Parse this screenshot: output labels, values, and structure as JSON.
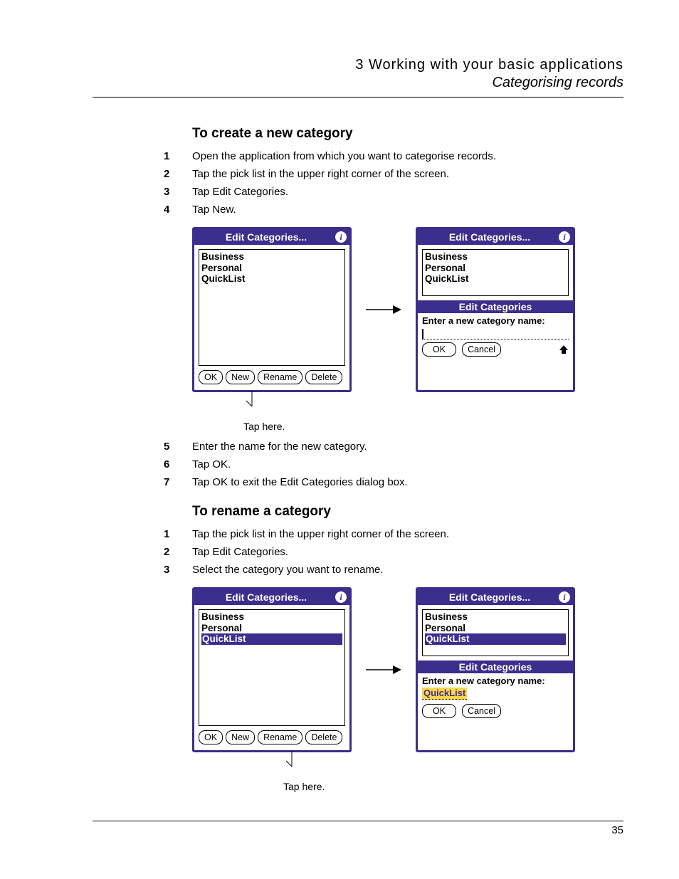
{
  "header": {
    "chapter": "3 Working with your basic applications",
    "section": "Categorising records"
  },
  "sec1": {
    "title": "To create a new category",
    "steps": [
      "Open the application from which you want to categorise records.",
      "Tap the pick list in the upper right corner of the screen.",
      "Tap Edit Categories.",
      "Tap New."
    ],
    "fig": {
      "left": {
        "title": "Edit Categories...",
        "items": [
          "Business",
          "Personal",
          "QuickList"
        ],
        "buttons": {
          "ok": "OK",
          "new": "New",
          "rename": "Rename",
          "delete": "Delete"
        }
      },
      "right": {
        "title": "Edit Categories...",
        "items": [
          "Business",
          "Personal",
          "QuickList"
        ],
        "sub": {
          "title": "Edit Categories",
          "prompt": "Enter a new category name:",
          "value": "",
          "ok": "OK",
          "cancel": "Cancel"
        }
      },
      "caption": "Tap here."
    },
    "steps2": [
      "Enter the name for the new category.",
      "Tap OK.",
      "Tap OK to exit the Edit Categories dialog box."
    ]
  },
  "sec2": {
    "title": "To rename a category",
    "steps": [
      "Tap the pick list in the upper right corner of the screen.",
      "Tap Edit Categories.",
      "Select the category you want to rename."
    ],
    "fig": {
      "left": {
        "title": "Edit Categories...",
        "items": [
          "Business",
          "Personal",
          "QuickList"
        ],
        "selected": 2,
        "buttons": {
          "ok": "OK",
          "new": "New",
          "rename": "Rename",
          "delete": "Delete"
        }
      },
      "right": {
        "title": "Edit Categories...",
        "items": [
          "Business",
          "Personal",
          "QuickList"
        ],
        "selected": 2,
        "sub": {
          "title": "Edit Categories",
          "prompt": "Enter a new category name:",
          "value": "QuickList",
          "ok": "OK",
          "cancel": "Cancel"
        }
      },
      "caption": "Tap here."
    }
  },
  "page_number": "35"
}
